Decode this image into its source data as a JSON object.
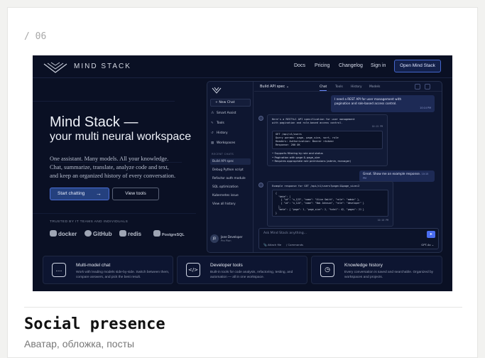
{
  "page": {
    "number": "/ 06",
    "title": "Social presence",
    "subtitle": "Аватар, обложка, посты"
  },
  "nav": {
    "brand": "MIND STACK",
    "links": [
      "Docs",
      "Pricing",
      "Changelog",
      "Sign in"
    ],
    "cta": "Open Mind Stack"
  },
  "hero": {
    "heading_line1": "Mind Stack —",
    "heading_line2": "your multi neural workspace",
    "paragraph_line1": "One assistant. Many models. All your knowledge.",
    "paragraph_line2": "Chat, summarize, translate, analyze code and text,",
    "paragraph_line3": "and keep an organized history of every conversation.",
    "primary_button": "Start chatting",
    "primary_arrow": "→",
    "secondary_button": "View tools",
    "trusted_label": "TRUSTED BY IT TEAMS AND INDIVIDUALS",
    "trusted_logos": [
      "docker",
      "GitHub",
      "redis",
      "PostgreSQL"
    ]
  },
  "app": {
    "new_chat": "New Chat",
    "new_chat_icon": "+",
    "sidebar_items": [
      {
        "icon": "⁂",
        "label": "Smart Assist"
      },
      {
        "icon": "✎",
        "label": "Tools"
      },
      {
        "icon": "↺",
        "label": "History"
      },
      {
        "icon": "▦",
        "label": "Workspaces"
      }
    ],
    "recent_heading": "RECENT CHATS",
    "recent_chats": [
      "Build API spec",
      "Debug Python script",
      "Refactor auth module",
      "SQL optimization",
      "Kubernetes issue",
      "View all history"
    ],
    "user_initials": "JD",
    "user_name": "Jane Developer",
    "user_plan": "Pro Plan",
    "chat_title": "Build API spec",
    "chat_title_caret": "⌄",
    "tabs": [
      "Chat",
      "Tools",
      "History",
      "Models"
    ],
    "messages": {
      "user1_line1": "I need a REST API for user management with",
      "user1_line2": "pagination and role-based access control.",
      "user1_time": "10:14 PM",
      "bot1_intro_line1": "Here's a RESTful API specification for user management",
      "bot1_intro_line2": "with pagination and role-based access control.",
      "bot1_time": "10:15 PM",
      "bot1_code": "GET /api/v1/users\nQuery params: page, page_size, sort, role\nHeaders: Authorization: Bearer <token>\nResponse: 200 OK",
      "bot1_bullets": [
        "• Supports filtering by role and status",
        "• Pagination with page & page_size",
        "• Requires appropriate role permissions (admin, manager)"
      ],
      "user2": "Great. Show me an example response.",
      "user2_time": "10:15 PM",
      "bot2_intro": "Example response for GET /api/v1/users?page=1&page_size=2",
      "bot2_code": "{\n  \"data\": [\n    { \"id\": \"u_123\", \"name\": \"Alice Smith\", \"role\": \"admin\" },\n    { \"id\": \"u_124\", \"name\": \"Bob Johnson\", \"role\": \"developer\" }\n  ],\n  \"meta\": { \"page\": 1, \"page_size\": 2, \"total\": 42, \"pages\": 21 }\n}",
      "bot2_time": "10:16 PM"
    },
    "composer_placeholder": "Ask Mind Stack anything...",
    "send_icon": "➤",
    "attach_label": "Attach file",
    "commands_label": "Commands",
    "model_label": "GPT-4o"
  },
  "features": [
    {
      "icon": "chat-bubble-icon",
      "glyph": "…",
      "title": "Multi-model chat",
      "desc": "Work with leading models side-by-side. Switch between them, compare answers, and pick the best result."
    },
    {
      "icon": "code-icon",
      "glyph": "</>",
      "title": "Developer tools",
      "desc": "Built-in tools for code analysis, refactoring, testing, and automation — all in one workspace."
    },
    {
      "icon": "clock-icon",
      "glyph": "◷",
      "title": "Knowledge history",
      "desc": "Every conversation is saved and searchable. Organized by workspaces and projects."
    }
  ],
  "colors": {
    "background": "#0a1024",
    "accent": "#4a6df0",
    "user_bubble": "#1d2a55"
  }
}
